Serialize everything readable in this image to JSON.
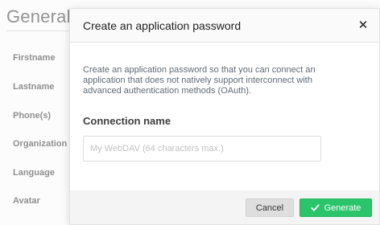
{
  "background_page": {
    "title": "General",
    "labels": [
      "Firstname",
      "Lastname",
      "Phone(s)",
      "Organization",
      "Language",
      "Avatar"
    ]
  },
  "dialog": {
    "title": "Create an application password",
    "close_icon": "close-icon",
    "description": "Create an application password so that you can connect an application that does not natively support interconnect with advanced authentication methods (OAuth).",
    "connection_name_label": "Connection name",
    "connection_name_value": "",
    "connection_name_placeholder": "My WebDAV (64 characters max.)",
    "cancel_label": "Cancel",
    "generate_label": "Generate",
    "generate_icon": "check-icon",
    "accent_color": "#2ac46b"
  }
}
